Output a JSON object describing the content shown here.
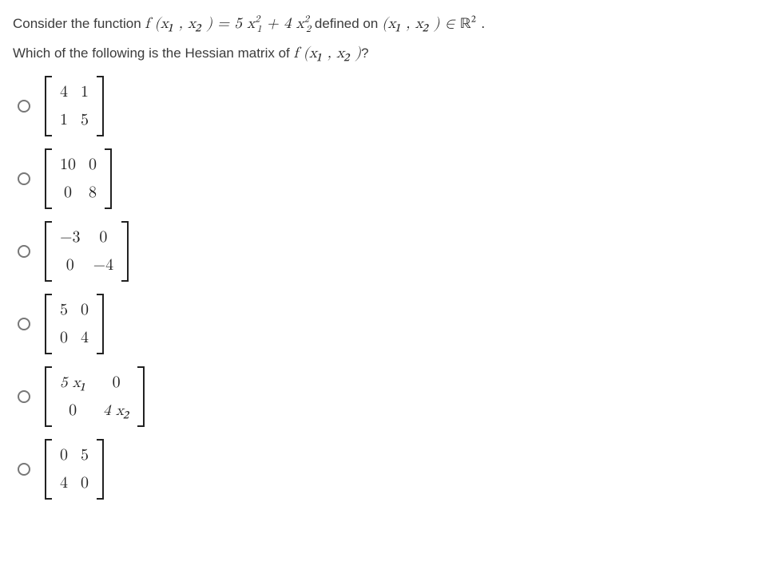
{
  "question": {
    "line1_pre": "Consider the function ",
    "fn_left": "f (x₁ , x₂ ) = 5 ",
    "fn_mid": " + 4 ",
    "defined_on": " defined on ",
    "pair_open": "(x₁ , x₂ ) ∈ ",
    "set_end": " .",
    "line2_pre": "Which of the following is the Hessian matrix of ",
    "fn_call": "f (x₁ , x₂ )",
    "line2_post": "?"
  },
  "options": [
    {
      "cells": [
        "4",
        "1",
        "1",
        "5"
      ]
    },
    {
      "cells": [
        "10",
        "0",
        "0",
        "8"
      ]
    },
    {
      "cells": [
        "−3",
        "0",
        "0",
        "−4"
      ]
    },
    {
      "cells": [
        "5",
        "0",
        "0",
        "4"
      ]
    },
    {
      "cells": [
        "5 x₁",
        "0",
        "0",
        "4 x₂"
      ]
    },
    {
      "cells": [
        "0",
        "5",
        "4",
        "0"
      ]
    }
  ]
}
